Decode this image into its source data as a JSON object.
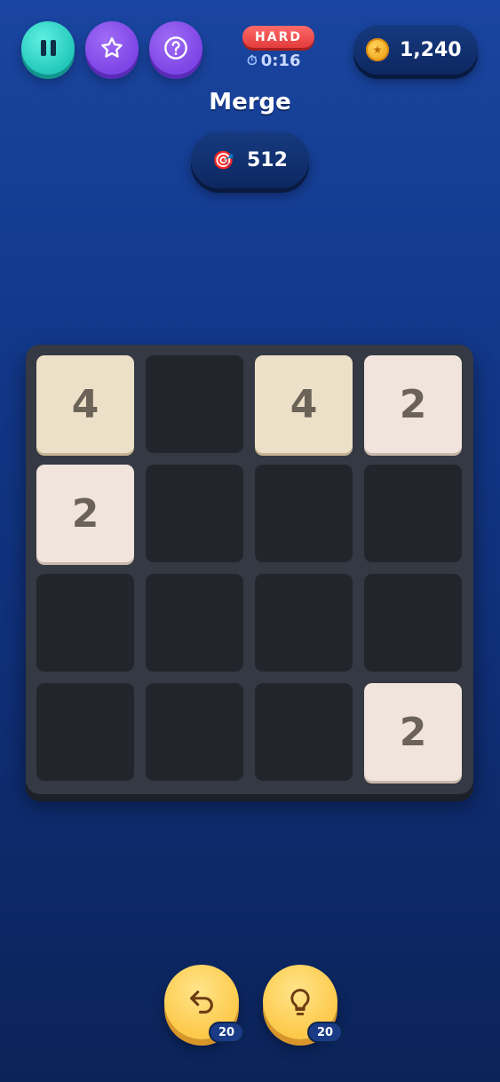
{
  "header": {
    "difficulty": "HARD",
    "timer": "0:16",
    "coins": "1,240",
    "buttons": {
      "pause": "pause-icon",
      "favorite": "star-icon",
      "help": "question-icon"
    }
  },
  "game": {
    "title": "Merge",
    "target": "512"
  },
  "board": {
    "rows": [
      [
        "4",
        "",
        "4",
        "2"
      ],
      [
        "2",
        "",
        "",
        ""
      ],
      [
        "",
        "",
        "",
        ""
      ],
      [
        "",
        "",
        "",
        "2"
      ]
    ]
  },
  "powerups": {
    "undo": {
      "icon": "undo-icon",
      "count": "20"
    },
    "hint": {
      "icon": "lightbulb-icon",
      "count": "20"
    }
  },
  "colors": {
    "tile_2": "#f0e4dc",
    "tile_4": "#ede0c8",
    "empty_cell": "#22252b",
    "board": "#343944",
    "difficulty_badge": "#e23b3b"
  }
}
